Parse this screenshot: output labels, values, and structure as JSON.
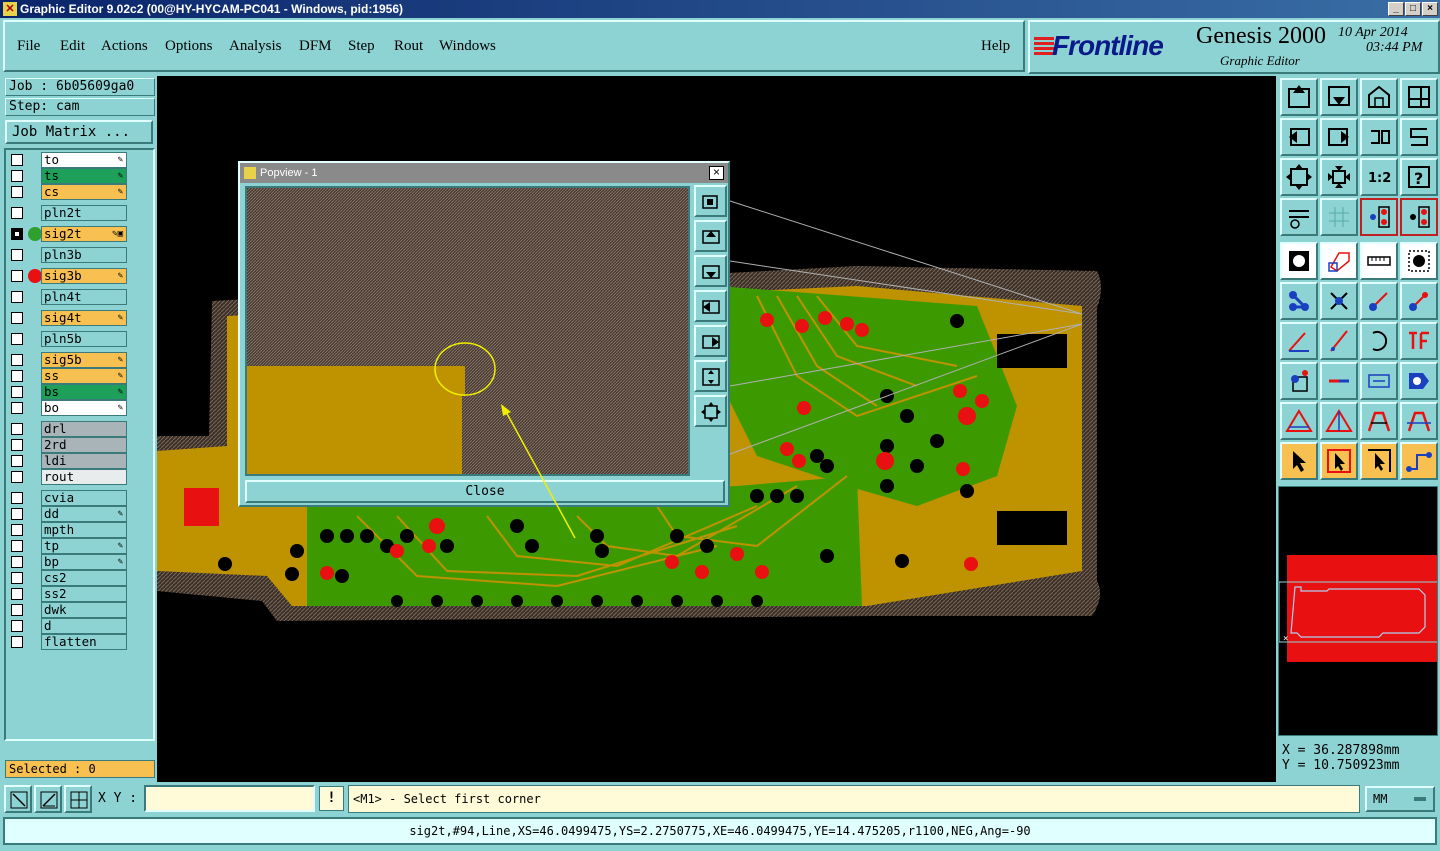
{
  "window": {
    "title": "Graphic Editor 9.02c2 (00@HY-HYCAM-PC041 - Windows, pid:1956)"
  },
  "menu": {
    "items": [
      "File",
      "Edit",
      "Actions",
      "Options",
      "Analysis",
      "DFM",
      "Step",
      "Rout",
      "Windows"
    ],
    "help": "Help"
  },
  "brand": {
    "logo": "Frontline",
    "product": "Genesis 2000",
    "subtitle": "Graphic Editor",
    "date": "10 Apr 2014",
    "time": "03:44 PM"
  },
  "job": {
    "job_line": "Job : 6b05609ga0",
    "step_line": "Step: cam",
    "matrix_button": "Job Matrix ..."
  },
  "layers": [
    {
      "name": "to",
      "color": "#ffffff",
      "mark": "✎"
    },
    {
      "name": "ts",
      "color": "#1ea05a",
      "mark": "✎"
    },
    {
      "name": "cs",
      "color": "#f8c050",
      "mark": "✎"
    },
    {
      "name": "pln2t",
      "color": "#8ed3d3",
      "mark": ""
    },
    {
      "name": "sig2t",
      "color": "#f8c050",
      "mark": "✎▣",
      "work": true,
      "dot": "#2ea02e"
    },
    {
      "name": "pln3b",
      "color": "#8ed3d3",
      "mark": ""
    },
    {
      "name": "sig3b",
      "color": "#f8c050",
      "mark": "✎",
      "dot": "#e81010"
    },
    {
      "name": "pln4t",
      "color": "#8ed3d3",
      "mark": ""
    },
    {
      "name": "sig4t",
      "color": "#f8c050",
      "mark": "✎"
    },
    {
      "name": "pln5b",
      "color": "#8ed3d3",
      "mark": ""
    },
    {
      "name": "sig5b",
      "color": "#f8c050",
      "mark": "✎"
    },
    {
      "name": "ss",
      "color": "#f8c050",
      "mark": "✎"
    },
    {
      "name": "bs",
      "color": "#1ea05a",
      "mark": "✎"
    },
    {
      "name": "bo",
      "color": "#ffffff",
      "mark": "✎"
    },
    {
      "name": "drl",
      "color": "#a8b4b8",
      "mark": ""
    },
    {
      "name": "2rd",
      "color": "#a8b4b8",
      "mark": ""
    },
    {
      "name": "ldi",
      "color": "#a8b4b8",
      "mark": ""
    },
    {
      "name": "rout",
      "color": "#e8ecec",
      "mark": ""
    },
    {
      "name": "cvia",
      "color": "#8ed3d3",
      "mark": ""
    },
    {
      "name": "dd",
      "color": "#8ed3d3",
      "mark": "✎"
    },
    {
      "name": "mpth",
      "color": "#8ed3d3",
      "mark": ""
    },
    {
      "name": "tp",
      "color": "#8ed3d3",
      "mark": "✎"
    },
    {
      "name": "bp",
      "color": "#8ed3d3",
      "mark": "✎"
    },
    {
      "name": "cs2",
      "color": "#8ed3d3",
      "mark": ""
    },
    {
      "name": "ss2",
      "color": "#8ed3d3",
      "mark": ""
    },
    {
      "name": "dwk",
      "color": "#8ed3d3",
      "mark": ""
    },
    {
      "name": "d",
      "color": "#8ed3d3",
      "mark": ""
    },
    {
      "name": "flatten",
      "color": "#8ed3d3",
      "mark": ""
    }
  ],
  "selected": "Selected : 0",
  "popview": {
    "title": "Popview - 1",
    "close_label": "Close"
  },
  "coords": {
    "x": "X = 36.287898mm",
    "y": "Y = 10.750923mm"
  },
  "bottom": {
    "xy_label": "X Y :",
    "xy_value": "",
    "warn": "!",
    "prompt": "<M1> - Select first corner",
    "units": "MM"
  },
  "status": "sig2t,#94,Line,XS=46.0499475,YS=2.2750775,XE=46.0499475,YE=14.475205,r1100,NEG,Ang=-90",
  "colors": {
    "board": "#bf9200",
    "copper": "#3c9a00",
    "pad_red": "#e81010",
    "pad_black": "#000000",
    "outline": "#5a4a3a",
    "accent_teal": "#8ed3d3"
  }
}
